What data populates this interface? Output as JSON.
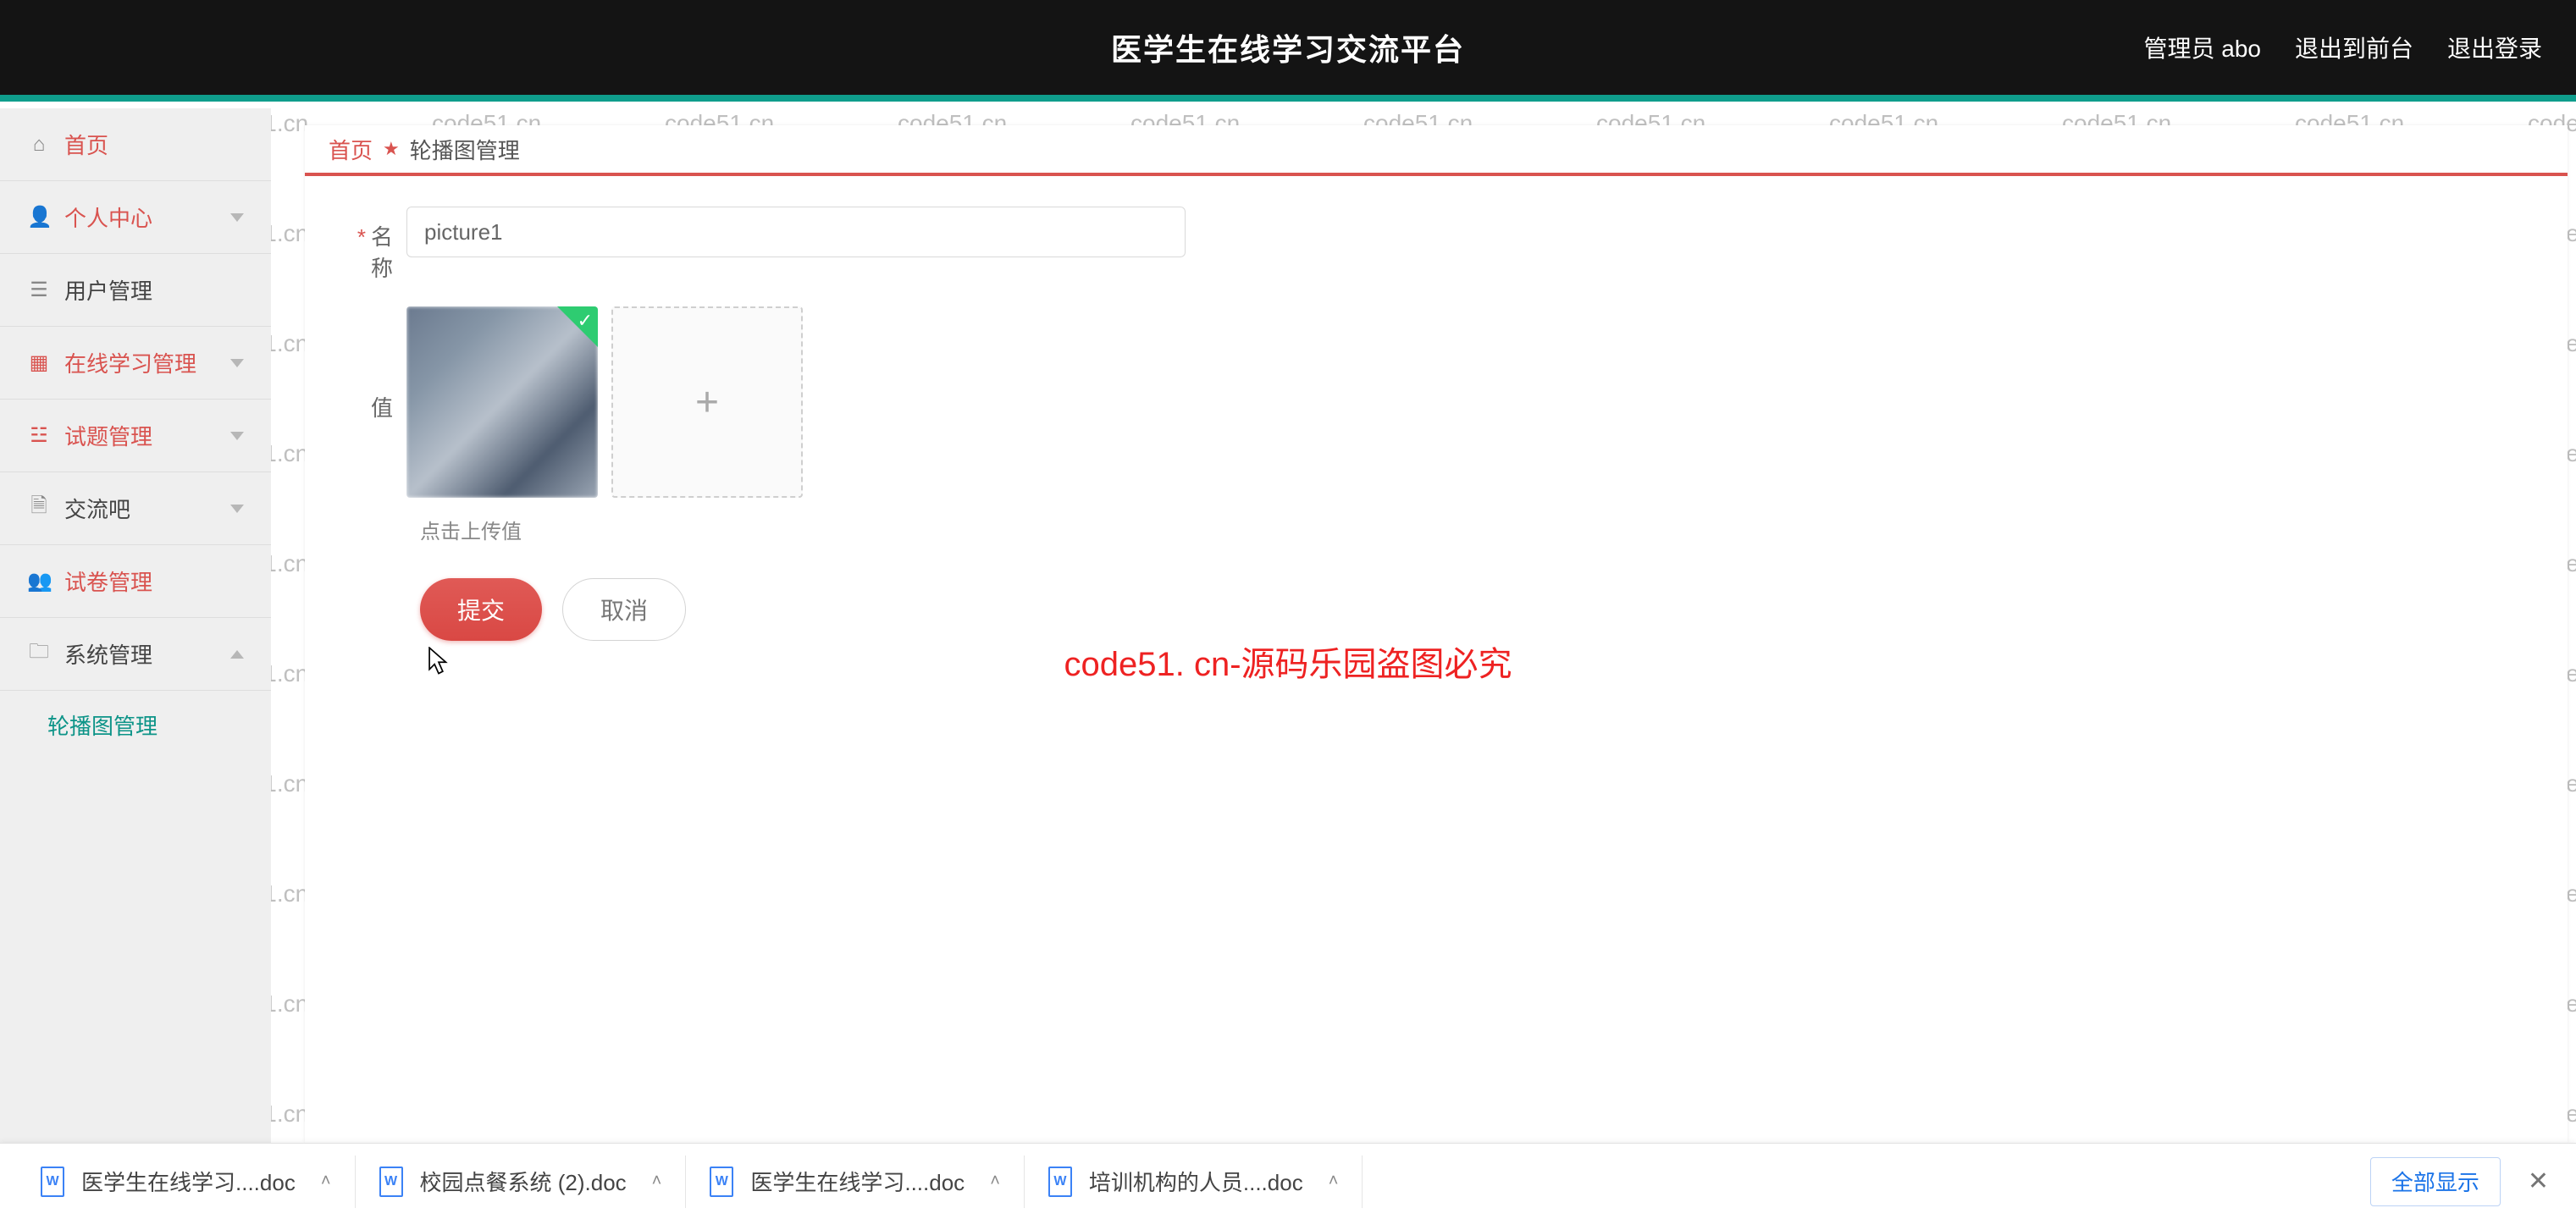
{
  "header": {
    "title": "医学生在线学习交流平台",
    "admin_label": "管理员 abo",
    "back_to_front": "退出到前台",
    "logout": "退出登录"
  },
  "sidebar": {
    "items": [
      {
        "label": "首页",
        "icon": "home-icon",
        "accent": true,
        "expand": "none"
      },
      {
        "label": "个人中心",
        "icon": "user-icon",
        "accent": true,
        "expand": "down"
      },
      {
        "label": "用户管理",
        "icon": "list-icon",
        "accent": false,
        "expand": "none"
      },
      {
        "label": "在线学习管理",
        "icon": "grid-icon",
        "accent": true,
        "expand": "down"
      },
      {
        "label": "试题管理",
        "icon": "lines-icon",
        "accent": true,
        "expand": "down"
      },
      {
        "label": "交流吧",
        "icon": "clip-icon",
        "accent": false,
        "expand": "down"
      },
      {
        "label": "试卷管理",
        "icon": "person-icon",
        "accent": true,
        "expand": "none"
      },
      {
        "label": "系统管理",
        "icon": "folder-icon",
        "accent": false,
        "expand": "up"
      }
    ],
    "sub_active": "轮播图管理"
  },
  "breadcrumb": {
    "home": "首页",
    "current": "轮播图管理"
  },
  "form": {
    "name_label": "名称",
    "name_value": "picture1",
    "value_label": "值",
    "upload_hint": "点击上传值",
    "submit": "提交",
    "cancel": "取消"
  },
  "downloads": {
    "items": [
      {
        "label": "医学生在线学习....doc"
      },
      {
        "label": "校园点餐系统 (2).doc"
      },
      {
        "label": "医学生在线学习....doc"
      },
      {
        "label": "培训机构的人员....doc"
      }
    ],
    "show_all": "全部显示"
  },
  "watermark": {
    "repeated": "code51.cn",
    "main": "code51. cn-源码乐园盗图必究"
  }
}
